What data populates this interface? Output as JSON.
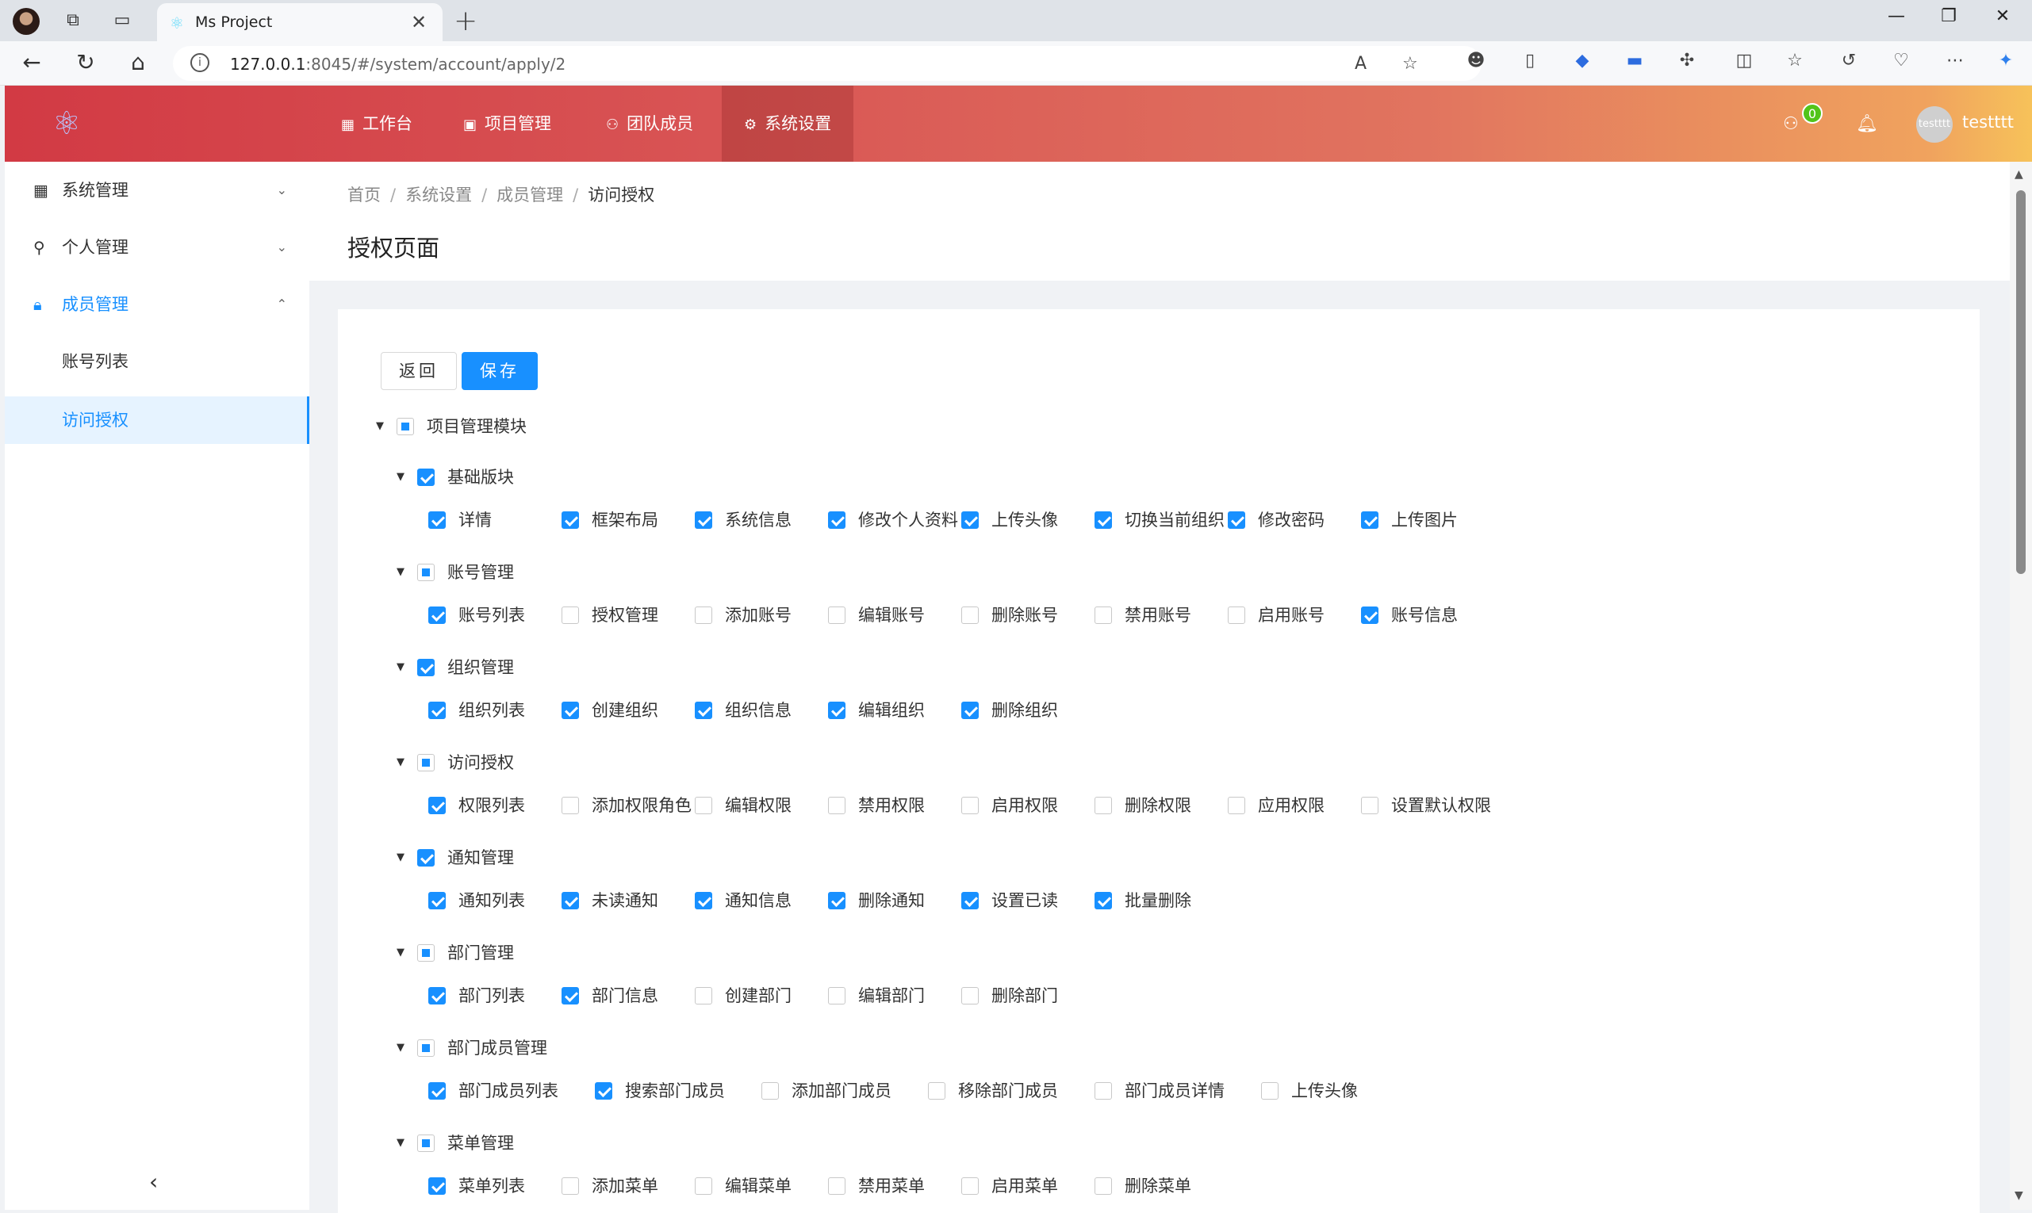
{
  "browser": {
    "tab_title": "Ms Project",
    "url_host": "127.0.0.1",
    "url_rest": ":8045/#/system/account/apply/2"
  },
  "header": {
    "nav": [
      {
        "label": "工作台",
        "icon": "grid-icon"
      },
      {
        "label": "项目管理",
        "icon": "project-icon"
      },
      {
        "label": "团队成员",
        "icon": "team-icon"
      },
      {
        "label": "系统设置",
        "icon": "gear-icon"
      }
    ],
    "active_nav": "系统设置",
    "badge_count": "0",
    "avatar_text": "testttt",
    "username": "testttt",
    "accent_color": "#1890ff"
  },
  "sidebar": {
    "menus": [
      {
        "label": "系统管理",
        "icon": "grid-icon"
      },
      {
        "label": "个人管理",
        "icon": "user-icon"
      },
      {
        "label": "成员管理",
        "icon": "lock-icon"
      }
    ],
    "submenus": [
      {
        "label": "账号列表"
      },
      {
        "label": "访问授权"
      }
    ]
  },
  "breadcrumb": [
    "首页",
    "系统设置",
    "成员管理",
    "访问授权"
  ],
  "page_title": "授权页面",
  "buttons": {
    "back": "返回",
    "save": "保存"
  },
  "tree": {
    "root": {
      "label": "项目管理模块",
      "state": "indeterminate"
    },
    "groups": [
      {
        "label": "基础版块",
        "state": "checked",
        "items": [
          {
            "label": "详情",
            "checked": true
          },
          {
            "label": "框架布局",
            "checked": true
          },
          {
            "label": "系统信息",
            "checked": true
          },
          {
            "label": "修改个人资料",
            "checked": true
          },
          {
            "label": "上传头像",
            "checked": true
          },
          {
            "label": "切换当前组织",
            "checked": true
          },
          {
            "label": "修改密码",
            "checked": true
          },
          {
            "label": "上传图片",
            "checked": true
          }
        ]
      },
      {
        "label": "账号管理",
        "state": "indeterminate",
        "items": [
          {
            "label": "账号列表",
            "checked": true
          },
          {
            "label": "授权管理",
            "checked": false
          },
          {
            "label": "添加账号",
            "checked": false
          },
          {
            "label": "编辑账号",
            "checked": false
          },
          {
            "label": "删除账号",
            "checked": false
          },
          {
            "label": "禁用账号",
            "checked": false
          },
          {
            "label": "启用账号",
            "checked": false
          },
          {
            "label": "账号信息",
            "checked": true
          }
        ]
      },
      {
        "label": "组织管理",
        "state": "checked",
        "items": [
          {
            "label": "组织列表",
            "checked": true
          },
          {
            "label": "创建组织",
            "checked": true
          },
          {
            "label": "组织信息",
            "checked": true
          },
          {
            "label": "编辑组织",
            "checked": true
          },
          {
            "label": "删除组织",
            "checked": true
          }
        ]
      },
      {
        "label": "访问授权",
        "state": "indeterminate",
        "items": [
          {
            "label": "权限列表",
            "checked": true
          },
          {
            "label": "添加权限角色",
            "checked": false
          },
          {
            "label": "编辑权限",
            "checked": false
          },
          {
            "label": "禁用权限",
            "checked": false
          },
          {
            "label": "启用权限",
            "checked": false
          },
          {
            "label": "删除权限",
            "checked": false
          },
          {
            "label": "应用权限",
            "checked": false
          },
          {
            "label": "设置默认权限",
            "checked": false
          }
        ]
      },
      {
        "label": "通知管理",
        "state": "checked",
        "items": [
          {
            "label": "通知列表",
            "checked": true
          },
          {
            "label": "未读通知",
            "checked": true
          },
          {
            "label": "通知信息",
            "checked": true
          },
          {
            "label": "删除通知",
            "checked": true
          },
          {
            "label": "设置已读",
            "checked": true
          },
          {
            "label": "批量删除",
            "checked": true
          }
        ]
      },
      {
        "label": "部门管理",
        "state": "indeterminate",
        "items": [
          {
            "label": "部门列表",
            "checked": true
          },
          {
            "label": "部门信息",
            "checked": true
          },
          {
            "label": "创建部门",
            "checked": false
          },
          {
            "label": "编辑部门",
            "checked": false
          },
          {
            "label": "删除部门",
            "checked": false
          }
        ]
      },
      {
        "label": "部门成员管理",
        "state": "indeterminate",
        "items": [
          {
            "label": "部门成员列表",
            "checked": true
          },
          {
            "label": "搜索部门成员",
            "checked": true
          },
          {
            "label": "添加部门成员",
            "checked": false
          },
          {
            "label": "移除部门成员",
            "checked": false
          },
          {
            "label": "部门成员详情",
            "checked": false
          },
          {
            "label": "上传头像",
            "checked": false
          }
        ]
      },
      {
        "label": "菜单管理",
        "state": "indeterminate",
        "items": [
          {
            "label": "菜单列表",
            "checked": true
          },
          {
            "label": "添加菜单",
            "checked": false
          },
          {
            "label": "编辑菜单",
            "checked": false
          },
          {
            "label": "禁用菜单",
            "checked": false
          },
          {
            "label": "启用菜单",
            "checked": false
          },
          {
            "label": "删除菜单",
            "checked": false
          }
        ]
      }
    ]
  }
}
